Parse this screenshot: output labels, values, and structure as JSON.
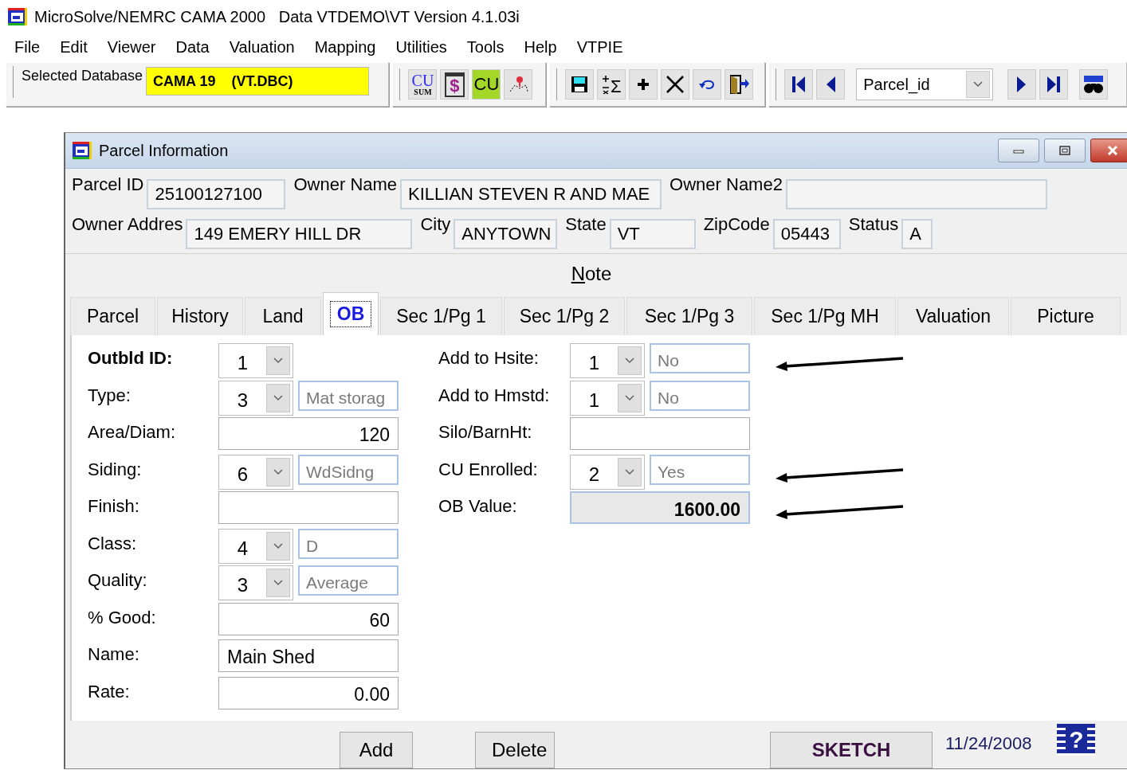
{
  "app_title": "MicroSolve/NEMRC CAMA 2000   Data VTDEMO\\VT Version 4.1.03i",
  "menu": [
    "File",
    "Edit",
    "Viewer",
    "Data",
    "Valuation",
    "Mapping",
    "Utilities",
    "Tools",
    "Help",
    "VTPIE"
  ],
  "toolbar": {
    "database_label": "Selected Database",
    "database_value": "CAMA 19    (VT.DBC)",
    "groups": [
      [
        {
          "kind": "cusum",
          "text": "CU",
          "subtext": "SUM"
        },
        {
          "kind": "dollar",
          "text": "$"
        },
        {
          "kind": "cu",
          "text": "CU"
        },
        {
          "kind": "map"
        }
      ],
      [
        {
          "kind": "save"
        },
        {
          "kind": "sigma",
          "text": "Σ"
        },
        {
          "kind": "plus"
        },
        {
          "kind": "cross"
        },
        {
          "kind": "undo"
        },
        {
          "kind": "exit"
        }
      ],
      [
        {
          "kind": "first"
        },
        {
          "kind": "prev"
        },
        {
          "kind": "combo",
          "text": "Parcel_id"
        },
        {
          "kind": "next"
        },
        {
          "kind": "last"
        },
        {
          "kind": "binoculars"
        }
      ]
    ]
  },
  "window": {
    "title": "Parcel Information",
    "header_rows": [
      [
        {
          "label": "Parcel ID",
          "value": "25100127100"
        },
        {
          "label": "Owner Name",
          "value": "KILLIAN STEVEN R AND MAE"
        },
        {
          "label": "Owner Name2"
        }
      ],
      [
        {
          "label": "Owner Addres",
          "value": "149 EMERY HILL DR"
        },
        {
          "label": "City",
          "value": "ANYTOWN"
        },
        {
          "label": "State",
          "value": "VT"
        },
        {
          "label": "ZipCode",
          "value": "05443"
        },
        {
          "label": "Status",
          "value": "A"
        }
      ]
    ],
    "note": "Note",
    "tabs": [
      {
        "label": "Parcel",
        "selected": false
      },
      {
        "label": "History",
        "selected": false
      },
      {
        "label": "Land",
        "selected": false
      },
      {
        "label": "OB",
        "selected": true
      },
      {
        "label": "Sec 1/Pg 1",
        "selected": false
      },
      {
        "label": "Sec 1/Pg 2",
        "selected": false
      },
      {
        "label": "Sec 1/Pg 3",
        "selected": false
      },
      {
        "label": "Sec 1/Pg MH",
        "selected": false
      },
      {
        "label": "Valuation",
        "selected": false
      },
      {
        "label": "Picture",
        "selected": false
      }
    ],
    "left_fields": [
      {
        "label": "Outbld ID:",
        "bold": true,
        "kind": "combo",
        "value": "1"
      },
      {
        "label": "Type:",
        "bold": false,
        "kind": "combo",
        "value": "3",
        "description": "Mat storag"
      },
      {
        "label": "Area/Diam:",
        "bold": false,
        "kind": "number",
        "value": "120"
      },
      {
        "label": "Siding:",
        "bold": false,
        "kind": "combo",
        "value": "6",
        "description": "WdSidng"
      },
      {
        "label": "Finish:",
        "bold": false,
        "kind": "text"
      },
      {
        "label": "Class:",
        "bold": false,
        "kind": "combo",
        "value": "4",
        "description": "D"
      },
      {
        "label": "Quality:",
        "bold": false,
        "kind": "combo",
        "value": "3",
        "description": "Average"
      },
      {
        "label": "% Good:",
        "bold": false,
        "kind": "number",
        "value": "60"
      },
      {
        "label": "Name:",
        "bold": false,
        "kind": "text",
        "value": "Main Shed"
      },
      {
        "label": "Rate:",
        "bold": false,
        "kind": "number",
        "value": "0.00"
      }
    ],
    "right_fields": [
      {
        "label": "Add to Hsite:",
        "kind": "combo",
        "value": "1",
        "description": "No",
        "annotated": true
      },
      {
        "label": "Add to Hmstd:",
        "kind": "combo",
        "value": "1",
        "description": "No",
        "annotated": false
      },
      {
        "label": "Silo/BarnHt:",
        "kind": "text",
        "annotated": false
      },
      {
        "label": "CU Enrolled:",
        "kind": "combo",
        "value": "2",
        "description": "Yes",
        "annotated": true
      },
      {
        "label": "OB Value:",
        "kind": "readonly",
        "value": "1600.00",
        "annotated": true
      }
    ],
    "buttons": [
      "Add",
      "Delete"
    ],
    "sketch": "SKETCH",
    "date": "11/24/2008",
    "help": "?"
  }
}
